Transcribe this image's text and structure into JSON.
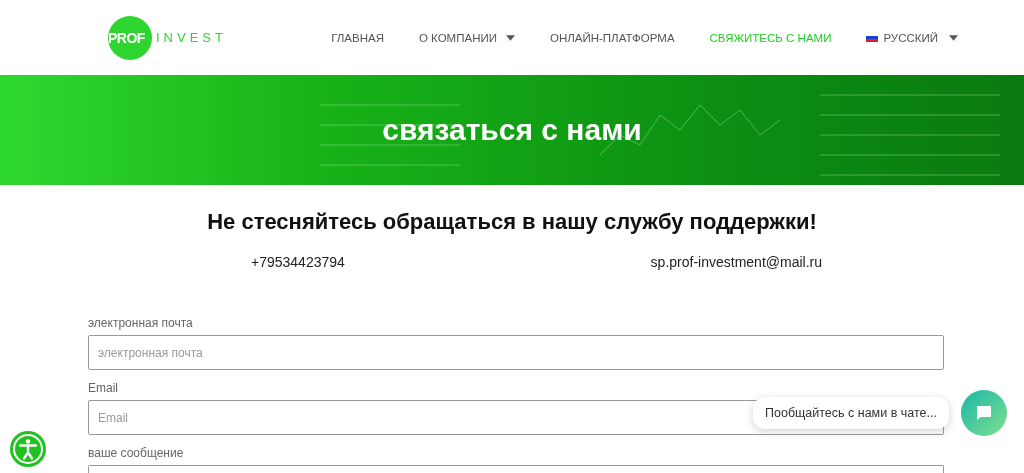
{
  "logo": {
    "prof": "PROF",
    "invest": "INVEST"
  },
  "nav": [
    {
      "label": "ГЛАВНАЯ",
      "selected": false,
      "dropdown": false
    },
    {
      "label": "О КОМПАНИИ",
      "selected": false,
      "dropdown": true
    },
    {
      "label": "ОНЛАЙН-ПЛАТФОРМА",
      "selected": false,
      "dropdown": false
    },
    {
      "label": "СВЯЖИТЕСЬ С НАМИ",
      "selected": true,
      "dropdown": false
    }
  ],
  "language": {
    "label": "РУССКИЙ"
  },
  "hero": {
    "title": "связаться с нами"
  },
  "heading": "Не стесняйтесь обращаться в нашу службу поддержки!",
  "contacts": {
    "phone": "+79534423794",
    "email": "sp.prof-investment@mail.ru"
  },
  "form": {
    "fields": [
      {
        "kind": "input",
        "label": "электронная почта",
        "placeholder": "электронная почта"
      },
      {
        "kind": "input",
        "label": "Email",
        "placeholder": "Email"
      },
      {
        "kind": "textarea",
        "label": "ваше сообщение"
      }
    ]
  },
  "chat": {
    "prompt": "Пообщайтесь с нами в чате..."
  }
}
